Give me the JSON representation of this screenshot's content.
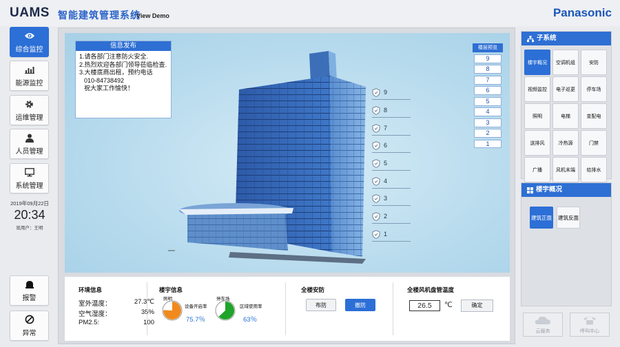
{
  "header": {
    "app_name": "UAMS",
    "app_title": "智能建筑管理系统",
    "app_subtitle": "View Demo",
    "brand": "Panasonic"
  },
  "nav": {
    "items": [
      {
        "label": "综合监控",
        "icon": "eye-icon",
        "active": true
      },
      {
        "label": "能源监控",
        "icon": "bar-chart-icon",
        "active": false
      },
      {
        "label": "运维管理",
        "icon": "gear-icon",
        "active": false
      },
      {
        "label": "人员管理",
        "icon": "user-icon",
        "active": false
      },
      {
        "label": "系统管理",
        "icon": "monitor-icon",
        "active": false
      }
    ],
    "date": "2019年09月22日",
    "time": "20:34",
    "user": "现用户：王明",
    "alarm_label": "报警",
    "abnormal_label": "异常"
  },
  "info_board": {
    "title": "信息发布",
    "lines": [
      "1.请各部门注意防火安全.",
      "2.热烈欢迎各部门领导莅临检查.",
      "3.大楼底商出租，预约电话",
      "010-84738492",
      "祝大家工作愉快！"
    ]
  },
  "floor_select": {
    "title": "楼层预览",
    "floors": [
      "9",
      "8",
      "7",
      "6",
      "5",
      "4",
      "3",
      "2",
      "1"
    ]
  },
  "floor_markers": [
    "9",
    "8",
    "7",
    "6",
    "5",
    "4",
    "3",
    "2",
    "1"
  ],
  "environment": {
    "title": "环境信息",
    "rows": [
      {
        "label": "室外温度：",
        "value": "27.3℃"
      },
      {
        "label": "空气湿度：",
        "value": "35%"
      },
      {
        "label": "PM2.5:",
        "value": "100"
      }
    ]
  },
  "building_info": {
    "title": "楼宇信息",
    "lighting": {
      "label": "照明",
      "desc": "设备开启率",
      "percent": 75.7,
      "display": "75.7％",
      "color": "#f08a1e"
    },
    "parking": {
      "label": "停车场",
      "desc": "区域使用率",
      "percent": 63,
      "display": "63％",
      "color": "#1fa32a"
    }
  },
  "security": {
    "title": "全楼安防",
    "arm_label": "布防",
    "disarm_label": "撤防",
    "active": "disarm"
  },
  "fan_coil": {
    "title": "全楼风机盘管温度",
    "value": "26.5",
    "unit": "℃",
    "confirm_label": "确定"
  },
  "subsystems": {
    "title": "子系统",
    "items": [
      {
        "label": "楼宇概况",
        "active": true
      },
      {
        "label": "空调机组",
        "active": false
      },
      {
        "label": "安防",
        "active": false
      },
      {
        "label": "视频监控",
        "active": false
      },
      {
        "label": "电子巡更",
        "active": false
      },
      {
        "label": "停车场",
        "active": false
      },
      {
        "label": "照明",
        "active": false
      },
      {
        "label": "电梯",
        "active": false
      },
      {
        "label": "变配电",
        "active": false
      },
      {
        "label": "送排风",
        "active": false
      },
      {
        "label": "冷热源",
        "active": false
      },
      {
        "label": "门禁",
        "active": false
      },
      {
        "label": "广播",
        "active": false
      },
      {
        "label": "风机末端",
        "active": false
      },
      {
        "label": "给排水",
        "active": false
      }
    ]
  },
  "overview": {
    "title": "楼宇概况",
    "front_label": "建筑正面",
    "back_label": "建筑反面"
  },
  "utility": {
    "cloud_label": "云服务",
    "call_label": "呼叫中心"
  }
}
